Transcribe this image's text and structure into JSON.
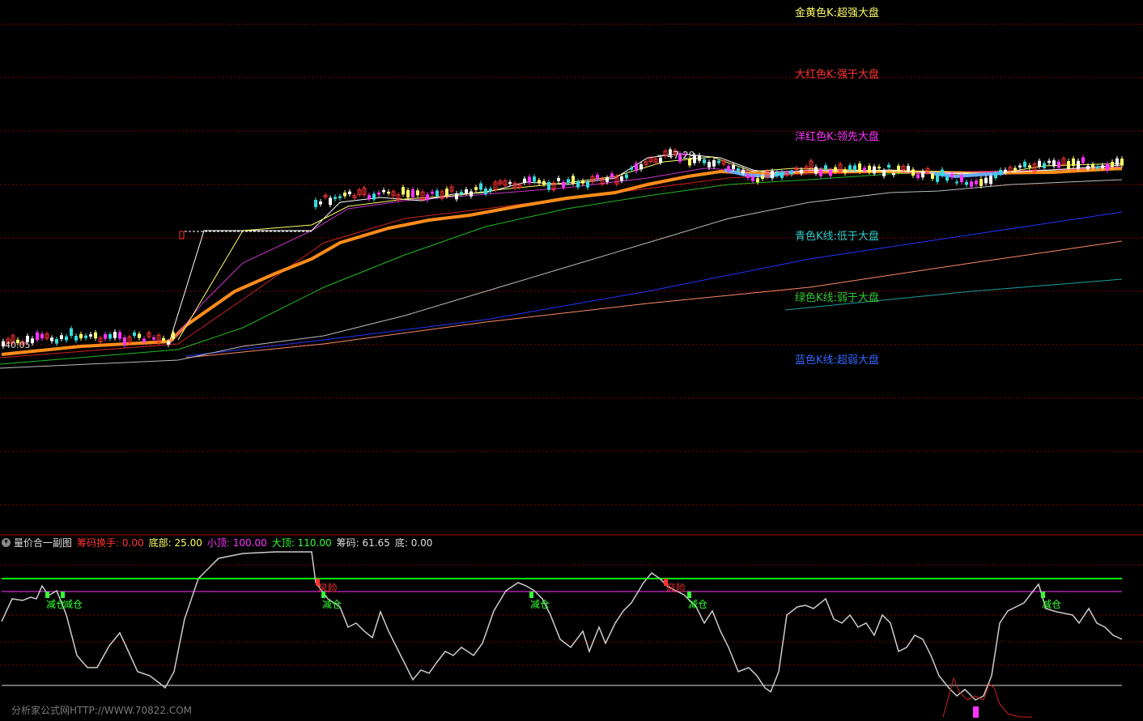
{
  "legend": [
    {
      "text": "金黄色K:超强大盘",
      "color": "#ffff66"
    },
    {
      "text": "大红色K:强于大盘",
      "color": "#ff3333"
    },
    {
      "text": "洋红色K:领先大盘",
      "color": "#ff33ff"
    },
    {
      "text": "青色K线:低于大盘",
      "color": "#33cccc"
    },
    {
      "text": "绿色K线:弱于大盘",
      "color": "#33cc33"
    },
    {
      "text": "蓝色K线:超弱大盘",
      "color": "#3366ff"
    }
  ],
  "price_labels": {
    "high": "47.29",
    "low": "40.05"
  },
  "sub_header": {
    "title": "量价合一副图",
    "items": [
      {
        "label": "筹码换手:",
        "value": "0.00",
        "color": "#ff3333"
      },
      {
        "label": "底部:",
        "value": "25.00",
        "color": "#ffff66"
      },
      {
        "label": "小顶:",
        "value": "100.00",
        "color": "#ff33ff"
      },
      {
        "label": "大顶:",
        "value": "110.00",
        "color": "#33ff33"
      },
      {
        "label": "筹码:",
        "value": "61.65",
        "color": "#dddddd"
      },
      {
        "label": "底:",
        "value": "0.00",
        "color": "#dddddd"
      }
    ]
  },
  "signals": {
    "reduce": "减仓",
    "risk": "风险"
  },
  "watermark": "分析家公式网HTTP://WWW.70822.COM",
  "colors": {
    "grid": "#8b0000",
    "ma_orange": "#ff8c1a",
    "ma_red": "#b22222",
    "ma_green": "#22bb22",
    "ma_white": "#cccccc",
    "ma_blue": "#2233ff",
    "ma_salmon": "#ff8866",
    "ma_teal": "#1e9e9e",
    "top_line": "#00ff00",
    "mid_line": "#ff33ff"
  }
}
